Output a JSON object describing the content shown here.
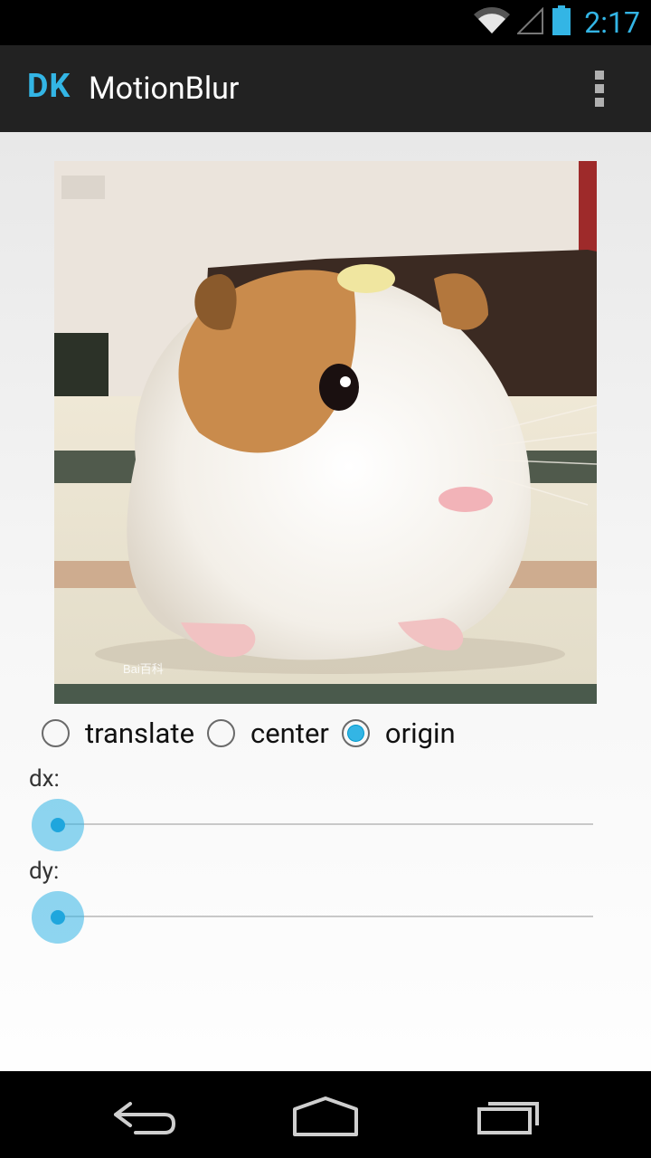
{
  "status_bar": {
    "time": "2:17"
  },
  "action_bar": {
    "app_icon_text": "DK",
    "title": "MotionBlur"
  },
  "image": {
    "watermark": "Bai百科"
  },
  "mode_options": [
    {
      "label": "translate",
      "checked": false
    },
    {
      "label": "center",
      "checked": false
    },
    {
      "label": "origin",
      "checked": true
    }
  ],
  "sliders": {
    "dx": {
      "label": "dx:",
      "value": 0
    },
    "dy": {
      "label": "dy:",
      "value": 0
    }
  },
  "colors": {
    "accent": "#33b5e5",
    "action_bar": "#222222"
  },
  "icons": [
    "wifi-icon",
    "signal-icon",
    "battery-icon",
    "overflow-menu-icon",
    "back-icon",
    "home-icon",
    "recents-icon"
  ]
}
